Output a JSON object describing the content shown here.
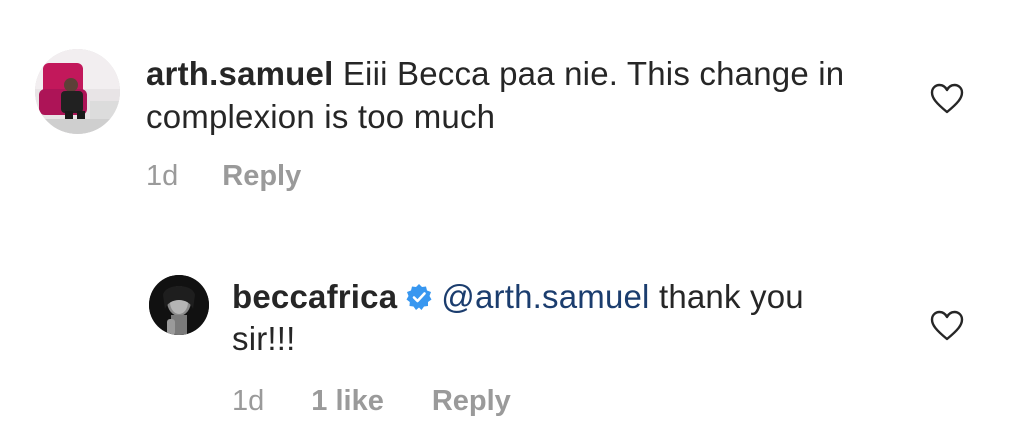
{
  "comments": [
    {
      "username": "arth.samuel",
      "text": "Eiii Becca paa nie. This change in complexion is too much",
      "time": "1d",
      "reply_label": "Reply",
      "avatar": "profile-photo-man-on-pink-chair",
      "like_icon": "heart-outline-icon"
    }
  ],
  "reply": {
    "username": "beccafrica",
    "verified": true,
    "mention": "@arth.samuel",
    "text": " thank you sir!!!",
    "time": "1d",
    "likes": "1 like",
    "reply_label": "Reply",
    "avatar": "profile-photo-woman-black-and-white",
    "like_icon": "heart-outline-icon"
  },
  "colors": {
    "text": "#262626",
    "meta": "#9a9a9a",
    "mention": "#1b3d6e",
    "verified": "#3897f0"
  }
}
